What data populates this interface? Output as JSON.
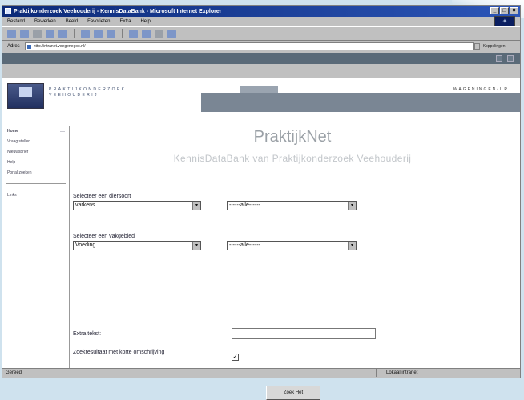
{
  "window": {
    "title": "Praktijkonderzoek Veehouderij - KennisDataBank - Microsoft Internet Explorer"
  },
  "menu": [
    "Bestand",
    "Bewerken",
    "Beeld",
    "Favorieten",
    "Extra",
    "Help"
  ],
  "address": {
    "label": "Adres",
    "url": "http://intranet.veegenegoo.nl/",
    "go_label": "Koppelingen"
  },
  "site": {
    "brand_line1": "PRAKTIJKONDERZOEK",
    "brand_line2": "VEEHOUDERIJ",
    "nav_right": "WAGENINGEN/UR"
  },
  "sidebar": {
    "items": [
      {
        "label": "Home",
        "active": true
      },
      {
        "label": "Vraag stellen"
      },
      {
        "label": "Nieuwsbrief"
      },
      {
        "label": "Help"
      },
      {
        "label": "Portal zoeken"
      }
    ],
    "footer_item": "Links"
  },
  "main": {
    "title": "PraktijkNet",
    "subtitle": "KennisDataBank van Praktijkonderzoek Veehouderij",
    "domain_label": "Selecteer een diersoort",
    "domain_value": "varkens",
    "domain_filter": "------alle------",
    "subject_label": "Selecteer een vakgebied",
    "subject_value": "Voeding",
    "subject_filter": "------alle------",
    "extra_text_label": "Extra tekst:",
    "extra_text_value": "",
    "checkbox_label": "Zoekresultaat met korte omschrijving",
    "checkbox_checked": true,
    "submit_label": "Zoek Het"
  },
  "status": {
    "left": "Gereed",
    "zone": "Lokaal intranet"
  }
}
